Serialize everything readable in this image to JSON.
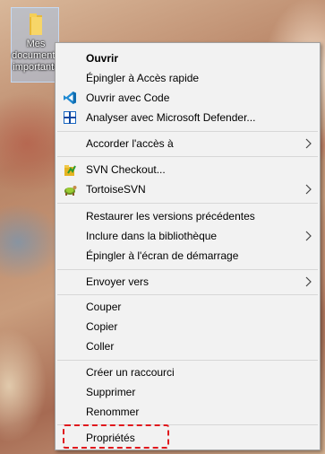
{
  "desktop": {
    "icon_label": "Mes\ndocuments\nimportants",
    "icon": "folder-icon"
  },
  "menu": {
    "items": [
      {
        "label": "Ouvrir",
        "bold": true
      },
      {
        "label": "Épingler à Accès rapide"
      },
      {
        "label": "Ouvrir avec Code",
        "icon": "vscode-icon"
      },
      {
        "label": "Analyser avec Microsoft Defender...",
        "icon": "defender-icon"
      },
      {
        "label": "Accorder l'accès à",
        "submenu": true
      },
      {
        "label": "SVN Checkout...",
        "icon": "svn-checkout-icon"
      },
      {
        "label": "TortoiseSVN",
        "icon": "tortoisesvn-icon",
        "submenu": true
      },
      {
        "label": "Restaurer les versions précédentes"
      },
      {
        "label": "Inclure dans la bibliothèque",
        "submenu": true
      },
      {
        "label": "Épingler à l'écran de démarrage"
      },
      {
        "label": "Envoyer vers",
        "submenu": true
      },
      {
        "label": "Couper"
      },
      {
        "label": "Copier"
      },
      {
        "label": "Coller"
      },
      {
        "label": "Créer un raccourci"
      },
      {
        "label": "Supprimer"
      },
      {
        "label": "Renommer"
      },
      {
        "label": "Propriétés",
        "highlighted": true
      }
    ]
  },
  "colors": {
    "menu_bg": "#f2f2f2",
    "separator": "#d7d7d7",
    "highlight_dash": "#e0181d"
  }
}
